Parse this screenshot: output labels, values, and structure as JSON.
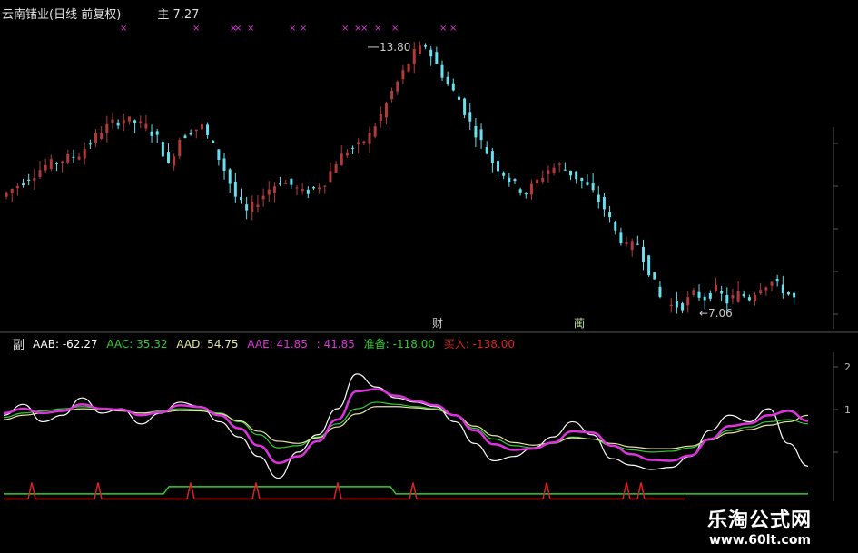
{
  "header": {
    "title": "云南锗业(日线 前复权)",
    "main_label": "主",
    "main_value": "7.27"
  },
  "annotations": {
    "high": "13.80",
    "low": "7.06",
    "event1": "财",
    "event2": "蔺"
  },
  "indicator": {
    "name": "副",
    "AAB": "AAB: -62.27",
    "AAC": "AAC: 35.32",
    "AAD": "AAD: 54.75",
    "AAE": "AAE: 41.85",
    "AAF": ": 41.85",
    "ready": "准备: -118.00",
    "buy": "买入: -138.00"
  },
  "watermark": {
    "line1": "乐淘公式网",
    "line2": "www.60lt.com"
  },
  "colors": {
    "bg": "#000000",
    "up": "#b33a3a",
    "down": "#66e0ee",
    "axis": "#555555",
    "aab": "#ffffff",
    "aac": "#33cc33",
    "aad": "#e6e6a0",
    "aae": "#dd33dd",
    "red_line": "#dd2222",
    "ready": "#33cc33",
    "buy": "#dd2222",
    "star": "#dd33dd"
  },
  "chart_data": [
    {
      "type": "candlestick",
      "title": "云南锗业(日线 前复权)",
      "price_range": [
        6.5,
        14.5
      ],
      "high_marker": 13.8,
      "low_marker": 7.06,
      "close_series": [
        9.9,
        10.1,
        10.3,
        10.5,
        10.7,
        10.8,
        10.9,
        11.0,
        11.3,
        11.6,
        11.8,
        11.9,
        11.8,
        11.7,
        11.4,
        10.7,
        11.4,
        11.6,
        11.7,
        11.2,
        10.6,
        9.9,
        9.5,
        9.8,
        10.1,
        10.3,
        10.2,
        10.0,
        10.1,
        10.3,
        10.8,
        11.1,
        11.2,
        11.5,
        12.0,
        12.6,
        13.1,
        13.6,
        13.8,
        13.3,
        12.8,
        12.4,
        11.8,
        11.3,
        10.8,
        10.5,
        10.2,
        10.0,
        10.3,
        10.6,
        10.7,
        10.5,
        10.3,
        10.0,
        9.6,
        9.0,
        8.6,
        8.7,
        8.0,
        7.3,
        7.1,
        7.1,
        7.4,
        7.3,
        7.5,
        7.2,
        7.4,
        7.3,
        7.6,
        7.7,
        7.5,
        7.27
      ],
      "signal_marks": 14
    },
    {
      "type": "line",
      "title": "副",
      "y_ticks": [
        "2",
        "1"
      ],
      "series": [
        {
          "name": "AAB",
          "last": -62.27,
          "values": [
            55,
            80,
            40,
            55,
            95,
            60,
            70,
            35,
            60,
            85,
            75,
            40,
            5,
            -40,
            -90,
            -30,
            10,
            70,
            150,
            120,
            95,
            85,
            75,
            40,
            -10,
            -50,
            -40,
            -20,
            5,
            40,
            10,
            -45,
            -60,
            -70,
            -65,
            -40,
            20,
            55,
            40,
            70,
            -10,
            -62.27
          ]
        },
        {
          "name": "AAC",
          "last": 35.32,
          "values": [
            50,
            60,
            65,
            70,
            75,
            70,
            65,
            60,
            65,
            70,
            68,
            60,
            40,
            10,
            -20,
            -15,
            5,
            35,
            70,
            85,
            80,
            75,
            70,
            55,
            25,
            0,
            -15,
            -20,
            -10,
            5,
            0,
            -15,
            -25,
            -30,
            -28,
            -20,
            0,
            20,
            28,
            40,
            45,
            35.32
          ]
        },
        {
          "name": "AAD",
          "last": 54.75,
          "values": [
            45,
            55,
            60,
            65,
            70,
            68,
            65,
            60,
            62,
            66,
            65,
            58,
            42,
            18,
            -5,
            -10,
            3,
            28,
            58,
            75,
            75,
            72,
            68,
            55,
            30,
            8,
            -8,
            -14,
            -8,
            3,
            0,
            -10,
            -18,
            -22,
            -22,
            -16,
            -2,
            14,
            22,
            32,
            40,
            54.75
          ]
        },
        {
          "name": "AAE",
          "last": 41.85,
          "values": [
            60,
            70,
            60,
            65,
            80,
            70,
            68,
            55,
            62,
            78,
            74,
            55,
            25,
            -15,
            -55,
            -40,
            -5,
            45,
            110,
            115,
            100,
            88,
            78,
            55,
            20,
            -12,
            -25,
            -22,
            -8,
            18,
            15,
            -15,
            -35,
            -48,
            -50,
            -38,
            0,
            30,
            36,
            55,
            65,
            41.85
          ]
        },
        {
          "name": "准备",
          "last": -118.0
        },
        {
          "name": "买入",
          "last": -138.0
        }
      ]
    }
  ]
}
